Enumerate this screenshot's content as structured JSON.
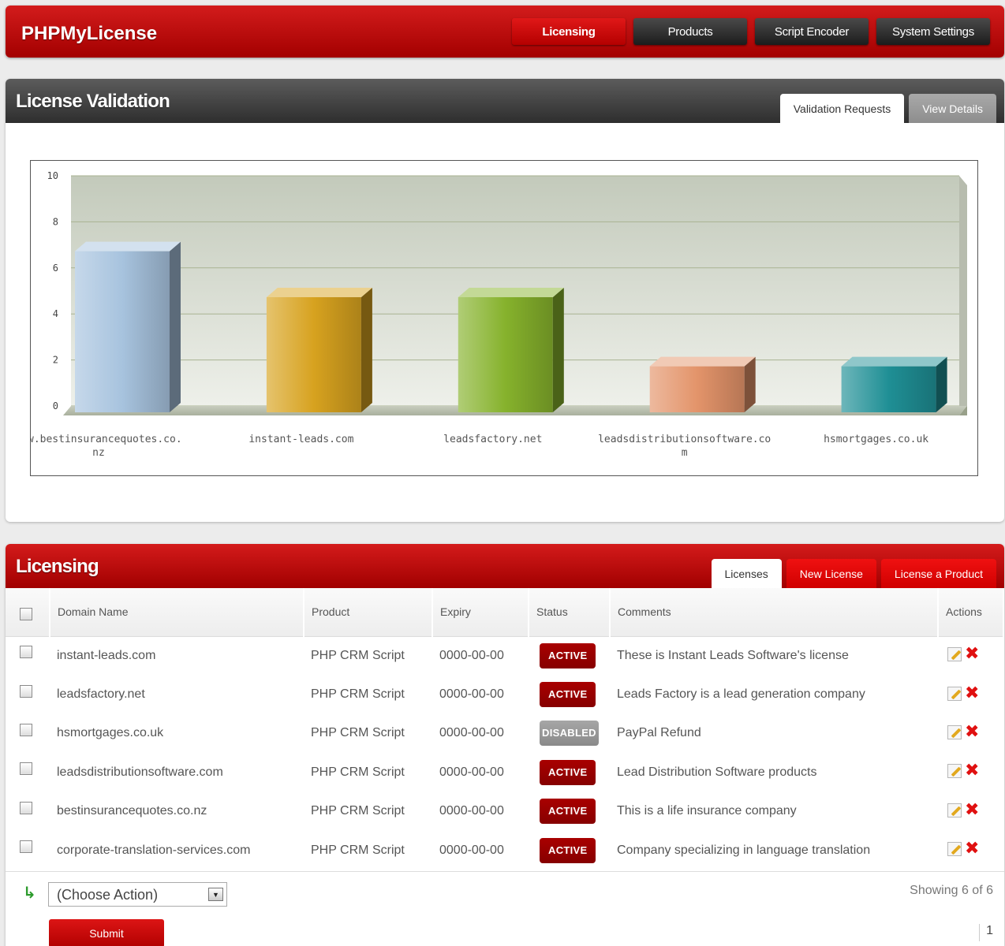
{
  "app": {
    "brand": "PHPMyLicense",
    "nav": [
      "Licensing",
      "Products",
      "Script Encoder",
      "System Settings"
    ],
    "active_nav": "Licensing"
  },
  "validation_panel": {
    "title": "License Validation",
    "tabs": [
      "Validation Requests",
      "View Details"
    ]
  },
  "chart_data": {
    "type": "bar",
    "categories": [
      "www.bestinsurancequotes.co.nz",
      "instant-leads.com",
      "leadsfactory.net",
      "leadsdistributionsoftware.com",
      "hsmortgages.co.uk"
    ],
    "category_label_lines": [
      [
        "www.bestinsurancequotes.co.",
        "nz"
      ],
      [
        "instant-leads.com"
      ],
      [
        "leadsfactory.net"
      ],
      [
        "leadsdistributionsoftware.co",
        "m"
      ],
      [
        "hsmortgages.co.uk"
      ]
    ],
    "values": [
      7,
      5,
      5,
      2,
      2
    ],
    "ylim": [
      0,
      10
    ],
    "yticks": [
      "0",
      "2",
      "4",
      "6",
      "8",
      "10"
    ],
    "grid": true,
    "colors": [
      "#a7c3de",
      "#d7a21f",
      "#86b22c",
      "#e3946a",
      "#1f8f95"
    ]
  },
  "licensing_panel": {
    "title": "Licensing",
    "tabs": [
      "Licenses",
      "New License",
      "License a Product"
    ],
    "columns": [
      "Domain Name",
      "Product",
      "Expiry",
      "Status",
      "Comments",
      "Actions"
    ],
    "rows": [
      {
        "domain": "instant-leads.com",
        "product": "PHP CRM Script",
        "expiry": "0000-00-00",
        "status": "ACTIVE",
        "comment": "These is Instant Leads Software's license"
      },
      {
        "domain": "leadsfactory.net",
        "product": "PHP CRM Script",
        "expiry": "0000-00-00",
        "status": "ACTIVE",
        "comment": "Leads Factory is a lead generation company"
      },
      {
        "domain": "hsmortgages.co.uk",
        "product": "PHP CRM Script",
        "expiry": "0000-00-00",
        "status": "DISABLED",
        "comment": "PayPal Refund"
      },
      {
        "domain": "leadsdistributionsoftware.com",
        "product": "PHP CRM Script",
        "expiry": "0000-00-00",
        "status": "ACTIVE",
        "comment": "Lead Distribution Software products"
      },
      {
        "domain": "bestinsurancequotes.co.nz",
        "product": "PHP CRM Script",
        "expiry": "0000-00-00",
        "status": "ACTIVE",
        "comment": "This is a life insurance company"
      },
      {
        "domain": "corporate-translation-services.com",
        "product": "PHP CRM Script",
        "expiry": "0000-00-00",
        "status": "ACTIVE",
        "comment": "Company specializing in language translation"
      }
    ],
    "bulk_action": "(Choose Action)",
    "submit_label": "Submit",
    "showing": "Showing 6 of 6",
    "page": "1"
  }
}
